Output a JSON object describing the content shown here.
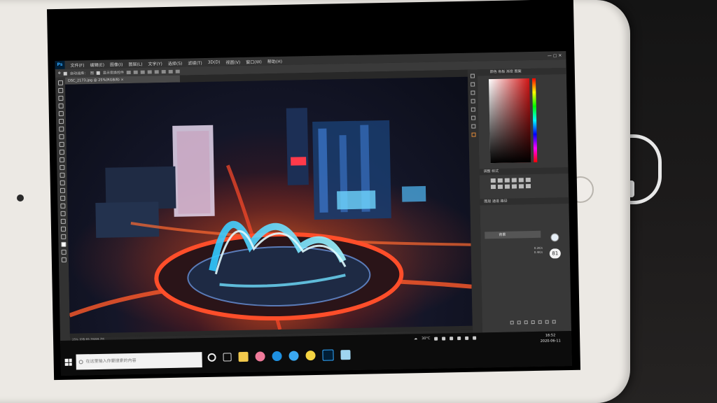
{
  "photoshop": {
    "app_logo": "Ps",
    "menu": [
      "文件(F)",
      "编辑(E)",
      "图像(I)",
      "图层(L)",
      "文字(Y)",
      "选择(S)",
      "滤镜(T)",
      "3D(D)",
      "视图(V)",
      "窗口(W)",
      "帮助(H)"
    ],
    "options": {
      "auto_select_label": "自动选择：",
      "auto_select_value": "图",
      "show_transform_label": "显示变换控件"
    },
    "document_tab": "DSC_2173.jpg @ 25%(RGB/8) ×",
    "status_bar": "25%   文档:69.7M/69.7M",
    "panels": {
      "color_title": "颜色   色板   渐变   图案",
      "adjustments_title": "调整   样式",
      "layers_title": "图层   通道   路径",
      "layer_name": "背景",
      "zoom_badge": "81",
      "float_stats": [
        "0.2K/s",
        "0.4K/s"
      ]
    }
  },
  "taskbar": {
    "search_placeholder": "在这里输入你要搜索的内容",
    "weather": "30°C",
    "time": "16:52",
    "date": "2020-06-11",
    "icons": [
      "task-view-icon",
      "file-explorer-icon",
      "heart-app-icon",
      "edge-icon",
      "ie-icon",
      "emoji-app-icon",
      "photoshop-taskbar-icon",
      "mail-icon"
    ]
  },
  "colors": {
    "ps_accent": "#31a8ff",
    "picker_hue": "#d11515",
    "keyboard_backlight": "#e22222"
  }
}
